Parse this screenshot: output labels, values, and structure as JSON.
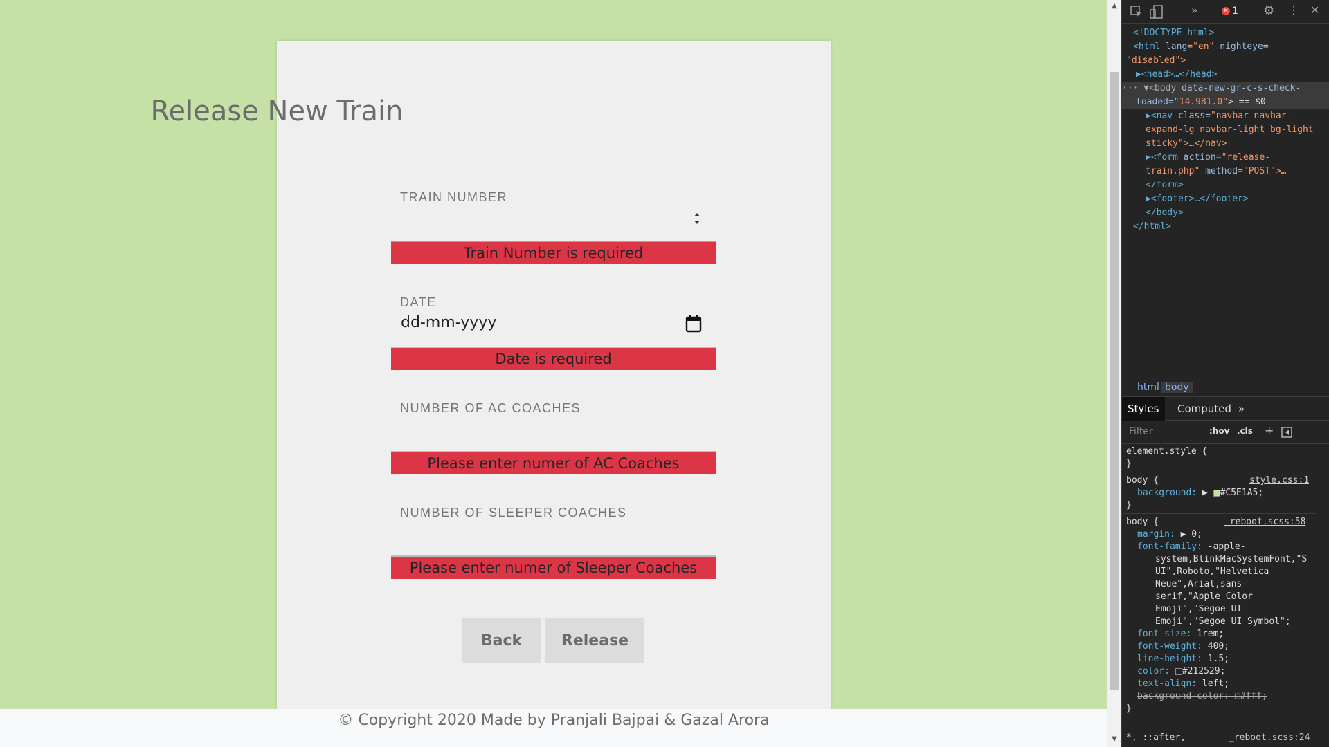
{
  "form": {
    "title": "Release New Train",
    "fields": [
      {
        "label": "TRAIN NUMBER",
        "value": "",
        "error": "Train Number is required"
      },
      {
        "label": "DATE",
        "value": "dd-mm-yyyy",
        "error": "Date is required"
      },
      {
        "label": "NUMBER OF AC COACHES",
        "value": "",
        "error": "Please enter numer of AC Coaches"
      },
      {
        "label": "NUMBER OF SLEEPER COACHES",
        "value": "",
        "error": "Please enter numer of Sleeper Coaches"
      }
    ],
    "back_label": "Back",
    "release_label": "Release"
  },
  "footer": {
    "text": "© Copyright 2020 Made by Pranjali Bajpai & Gazal Arora"
  },
  "devtools": {
    "error_count": "1",
    "dom": {
      "l1": "<!DOCTYPE html>",
      "l2a": "<html ",
      "l2b": "lang",
      "l2c": "=\"en\" ",
      "l2d": "nighteye=",
      "l3": "\"disabled\">",
      "l4": "▶<head>…</head>",
      "l5a": "··· ▼<body ",
      "l5b": "data-new-gr-c-s-check-",
      "l6a": "loaded=",
      "l6b": "\"14.981.0\"",
      "l6c": "> == $0",
      "l7a": "▶<nav ",
      "l7b": "class=",
      "l7c": "\"navbar navbar-",
      "l8": "expand-lg navbar-light bg-light",
      "l9": "sticky\">…</nav>",
      "l10a": "▶<form ",
      "l10b": "action=",
      "l10c": "\"release-",
      "l11a": "train.php\" ",
      "l11b": "method=",
      "l11c": "\"POST\">…",
      "l12": "</form>",
      "l13": "▶<footer>…</footer>",
      "l14": "</body>",
      "l15": "</html>"
    },
    "breadcrumbs": [
      "html",
      "body"
    ],
    "tabs": [
      "Styles",
      "Computed",
      "»"
    ],
    "filter_placeholder": "Filter",
    "hov": ":hov",
    "cls": ".cls",
    "styles": {
      "s1": "element.style {",
      "s2": "}",
      "s3a": "body {",
      "s3b": "style.css:1",
      "s4a": "background:",
      "s4b": "#C5E1A5;",
      "s5": "}",
      "s6a": "body {",
      "s6b": "_reboot.scss:58",
      "s7a": "margin:",
      "s7b": "▶ 0;",
      "s8a": "font-family:",
      "s8b": "-apple-",
      "s9": "system,BlinkMacSystemFont,\"S",
      "s10": "UI\",Roboto,\"Helvetica",
      "s11": "Neue\",Arial,sans-",
      "s12": "serif,\"Apple Color",
      "s13": "Emoji\",\"Segoe UI",
      "s14": "Emoji\",\"Segoe UI Symbol\";",
      "s15a": "font-size:",
      "s15b": "1rem;",
      "s16a": "font-weight:",
      "s16b": "400;",
      "s17a": "line-height:",
      "s17b": "1.5;",
      "s18a": "color:",
      "s18b": "#212529;",
      "s19a": "text-align:",
      "s19b": "left;",
      "s20": "background-color: □#fff;",
      "s21": "}",
      "s22a": "*, ::after,",
      "s22b": "_reboot.scss:24"
    },
    "swatch_bg": "#C5E1A5",
    "swatch_color": "#212529"
  }
}
